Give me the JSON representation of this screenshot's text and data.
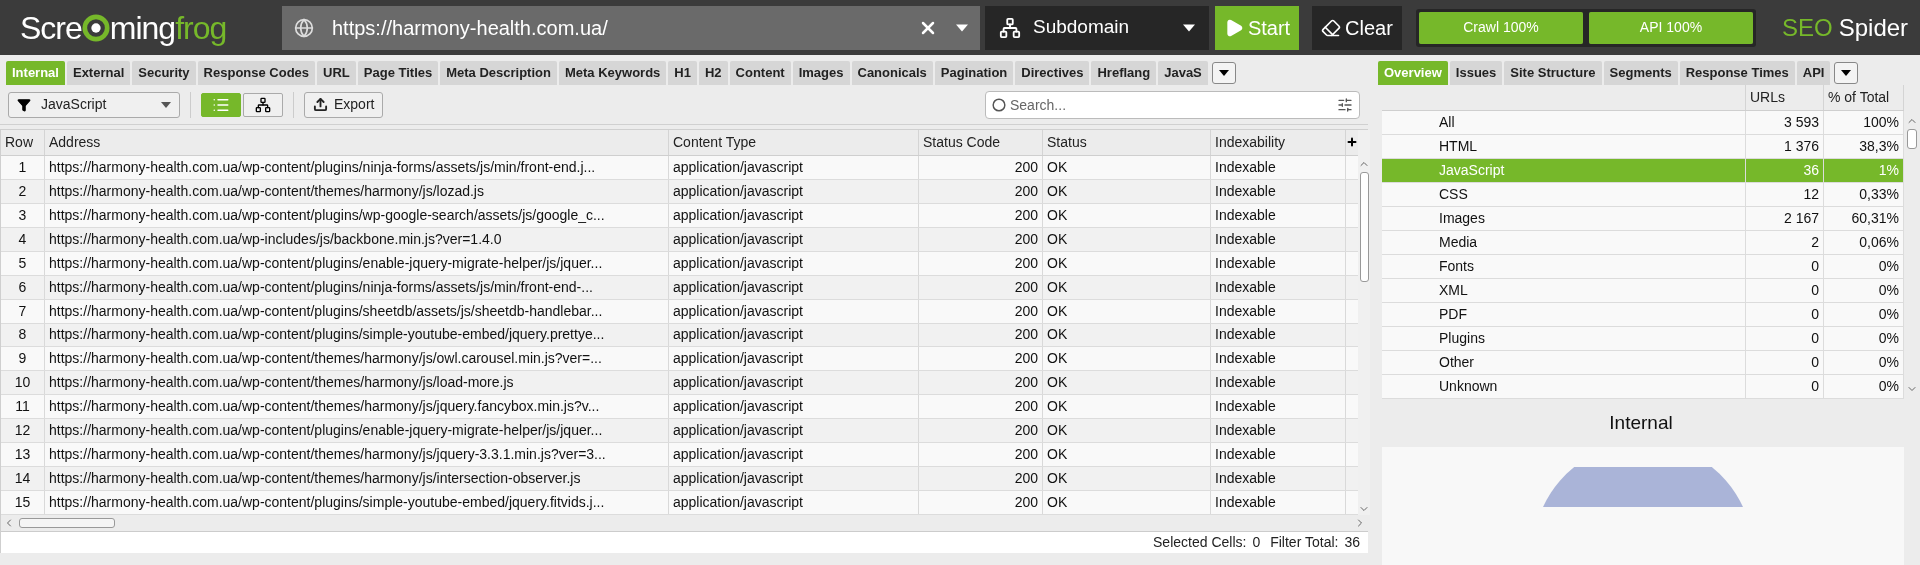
{
  "logo": {
    "parts": [
      "Scre",
      "ming",
      "frog"
    ]
  },
  "url_field": {
    "value": "https://harmony-health.com.ua/"
  },
  "mode_dropdown": {
    "value": "Subdomain"
  },
  "buttons": [
    {
      "kind": "start",
      "label": "Start"
    },
    {
      "kind": "clear",
      "label": "Clear"
    }
  ],
  "progress": [
    {
      "label": "Crawl 100%",
      "level": 1
    },
    {
      "label": "API 100%",
      "level": 1
    }
  ],
  "brand": {
    "parts": [
      "SEO",
      "Spider"
    ]
  },
  "main_tabs": [
    {
      "label": "Internal",
      "selected": true
    },
    {
      "label": "External",
      "selected": false
    },
    {
      "label": "Security",
      "selected": false
    },
    {
      "label": "Response Codes",
      "selected": false
    },
    {
      "label": "URL",
      "selected": false
    },
    {
      "label": "Page Titles",
      "selected": false
    },
    {
      "label": "Meta Description",
      "selected": false
    },
    {
      "label": "Meta Keywords",
      "selected": false
    },
    {
      "label": "H1",
      "selected": false
    },
    {
      "label": "H2",
      "selected": false
    },
    {
      "label": "Content",
      "selected": false
    },
    {
      "label": "Images",
      "selected": false
    },
    {
      "label": "Canonicals",
      "selected": false
    },
    {
      "label": "Pagination",
      "selected": false
    },
    {
      "label": "Directives",
      "selected": false
    },
    {
      "label": "Hreflang",
      "selected": false
    },
    {
      "label": "JavaS",
      "selected": false
    }
  ],
  "filter_dropdown": {
    "value": "JavaScript"
  },
  "view_toggles": [
    {
      "kind": "list",
      "selected": true
    },
    {
      "kind": "tree",
      "selected": false
    }
  ],
  "export_button": {
    "label": "Export"
  },
  "search": {
    "placeholder": "Search..."
  },
  "table": {
    "columns": [
      "Row",
      "Address",
      "Content Type",
      "Status Code",
      "Status",
      "Indexability"
    ],
    "rows": [
      [
        "1",
        "https://harmony-health.com.ua/wp-content/plugins/ninja-forms/assets/js/min/front-end.j...",
        "application/javascript",
        "200",
        "OK",
        "Indexable"
      ],
      [
        "2",
        "https://harmony-health.com.ua/wp-content/themes/harmony/js/lozad.js",
        "application/javascript",
        "200",
        "OK",
        "Indexable"
      ],
      [
        "3",
        "https://harmony-health.com.ua/wp-content/plugins/wp-google-search/assets/js/google_c...",
        "application/javascript",
        "200",
        "OK",
        "Indexable"
      ],
      [
        "4",
        "https://harmony-health.com.ua/wp-includes/js/backbone.min.js?ver=1.4.0",
        "application/javascript",
        "200",
        "OK",
        "Indexable"
      ],
      [
        "5",
        "https://harmony-health.com.ua/wp-content/plugins/enable-jquery-migrate-helper/js/jquer...",
        "application/javascript",
        "200",
        "OK",
        "Indexable"
      ],
      [
        "6",
        "https://harmony-health.com.ua/wp-content/plugins/ninja-forms/assets/js/min/front-end-...",
        "application/javascript",
        "200",
        "OK",
        "Indexable"
      ],
      [
        "7",
        "https://harmony-health.com.ua/wp-content/plugins/sheetdb/assets/js/sheetdb-handlebar...",
        "application/javascript",
        "200",
        "OK",
        "Indexable"
      ],
      [
        "8",
        "https://harmony-health.com.ua/wp-content/plugins/simple-youtube-embed/jquery.prettye...",
        "application/javascript",
        "200",
        "OK",
        "Indexable"
      ],
      [
        "9",
        "https://harmony-health.com.ua/wp-content/themes/harmony/js/owl.carousel.min.js?ver=...",
        "application/javascript",
        "200",
        "OK",
        "Indexable"
      ],
      [
        "10",
        "https://harmony-health.com.ua/wp-content/themes/harmony/js/load-more.js",
        "application/javascript",
        "200",
        "OK",
        "Indexable"
      ],
      [
        "11",
        "https://harmony-health.com.ua/wp-content/themes/harmony/js/jquery.fancybox.min.js?v...",
        "application/javascript",
        "200",
        "OK",
        "Indexable"
      ],
      [
        "12",
        "https://harmony-health.com.ua/wp-content/plugins/enable-jquery-migrate-helper/js/jquer...",
        "application/javascript",
        "200",
        "OK",
        "Indexable"
      ],
      [
        "13",
        "https://harmony-health.com.ua/wp-content/themes/harmony/js/jquery-3.3.1.min.js?ver=3...",
        "application/javascript",
        "200",
        "OK",
        "Indexable"
      ],
      [
        "14",
        "https://harmony-health.com.ua/wp-content/themes/harmony/js/intersection-observer.js",
        "application/javascript",
        "200",
        "OK",
        "Indexable"
      ],
      [
        "15",
        "https://harmony-health.com.ua/wp-content/plugins/simple-youtube-embed/jquery.fitvids.j...",
        "application/javascript",
        "200",
        "OK",
        "Indexable"
      ]
    ]
  },
  "status_bar": [
    {
      "label": "Selected Cells:",
      "value": "0"
    },
    {
      "label": "Filter Total:",
      "value": "36"
    }
  ],
  "side_tabs": [
    {
      "label": "Overview",
      "selected": true
    },
    {
      "label": "Issues",
      "selected": false
    },
    {
      "label": "Site Structure",
      "selected": false
    },
    {
      "label": "Segments",
      "selected": false
    },
    {
      "label": "Response Times",
      "selected": false
    },
    {
      "label": "API",
      "selected": false
    }
  ],
  "overview": {
    "columns": [
      "URLs",
      "% of Total"
    ],
    "rows": [
      {
        "label": "All",
        "urls": "3 593",
        "percent": "100%",
        "selected": false
      },
      {
        "label": "HTML",
        "urls": "1 376",
        "percent": "38,3%",
        "selected": false
      },
      {
        "label": "JavaScript",
        "urls": "36",
        "percent": "1%",
        "selected": true
      },
      {
        "label": "CSS",
        "urls": "12",
        "percent": "0,33%",
        "selected": false
      },
      {
        "label": "Images",
        "urls": "2 167",
        "percent": "60,31%",
        "selected": false
      },
      {
        "label": "Media",
        "urls": "2",
        "percent": "0,06%",
        "selected": false
      },
      {
        "label": "Fonts",
        "urls": "0",
        "percent": "0%",
        "selected": false
      },
      {
        "label": "XML",
        "urls": "0",
        "percent": "0%",
        "selected": false
      },
      {
        "label": "PDF",
        "urls": "0",
        "percent": "0%",
        "selected": false
      },
      {
        "label": "Plugins",
        "urls": "0",
        "percent": "0%",
        "selected": false
      },
      {
        "label": "Other",
        "urls": "0",
        "percent": "0%",
        "selected": false
      },
      {
        "label": "Unknown",
        "urls": "0",
        "percent": "0%",
        "selected": false
      }
    ]
  },
  "chart_title": "Internal"
}
